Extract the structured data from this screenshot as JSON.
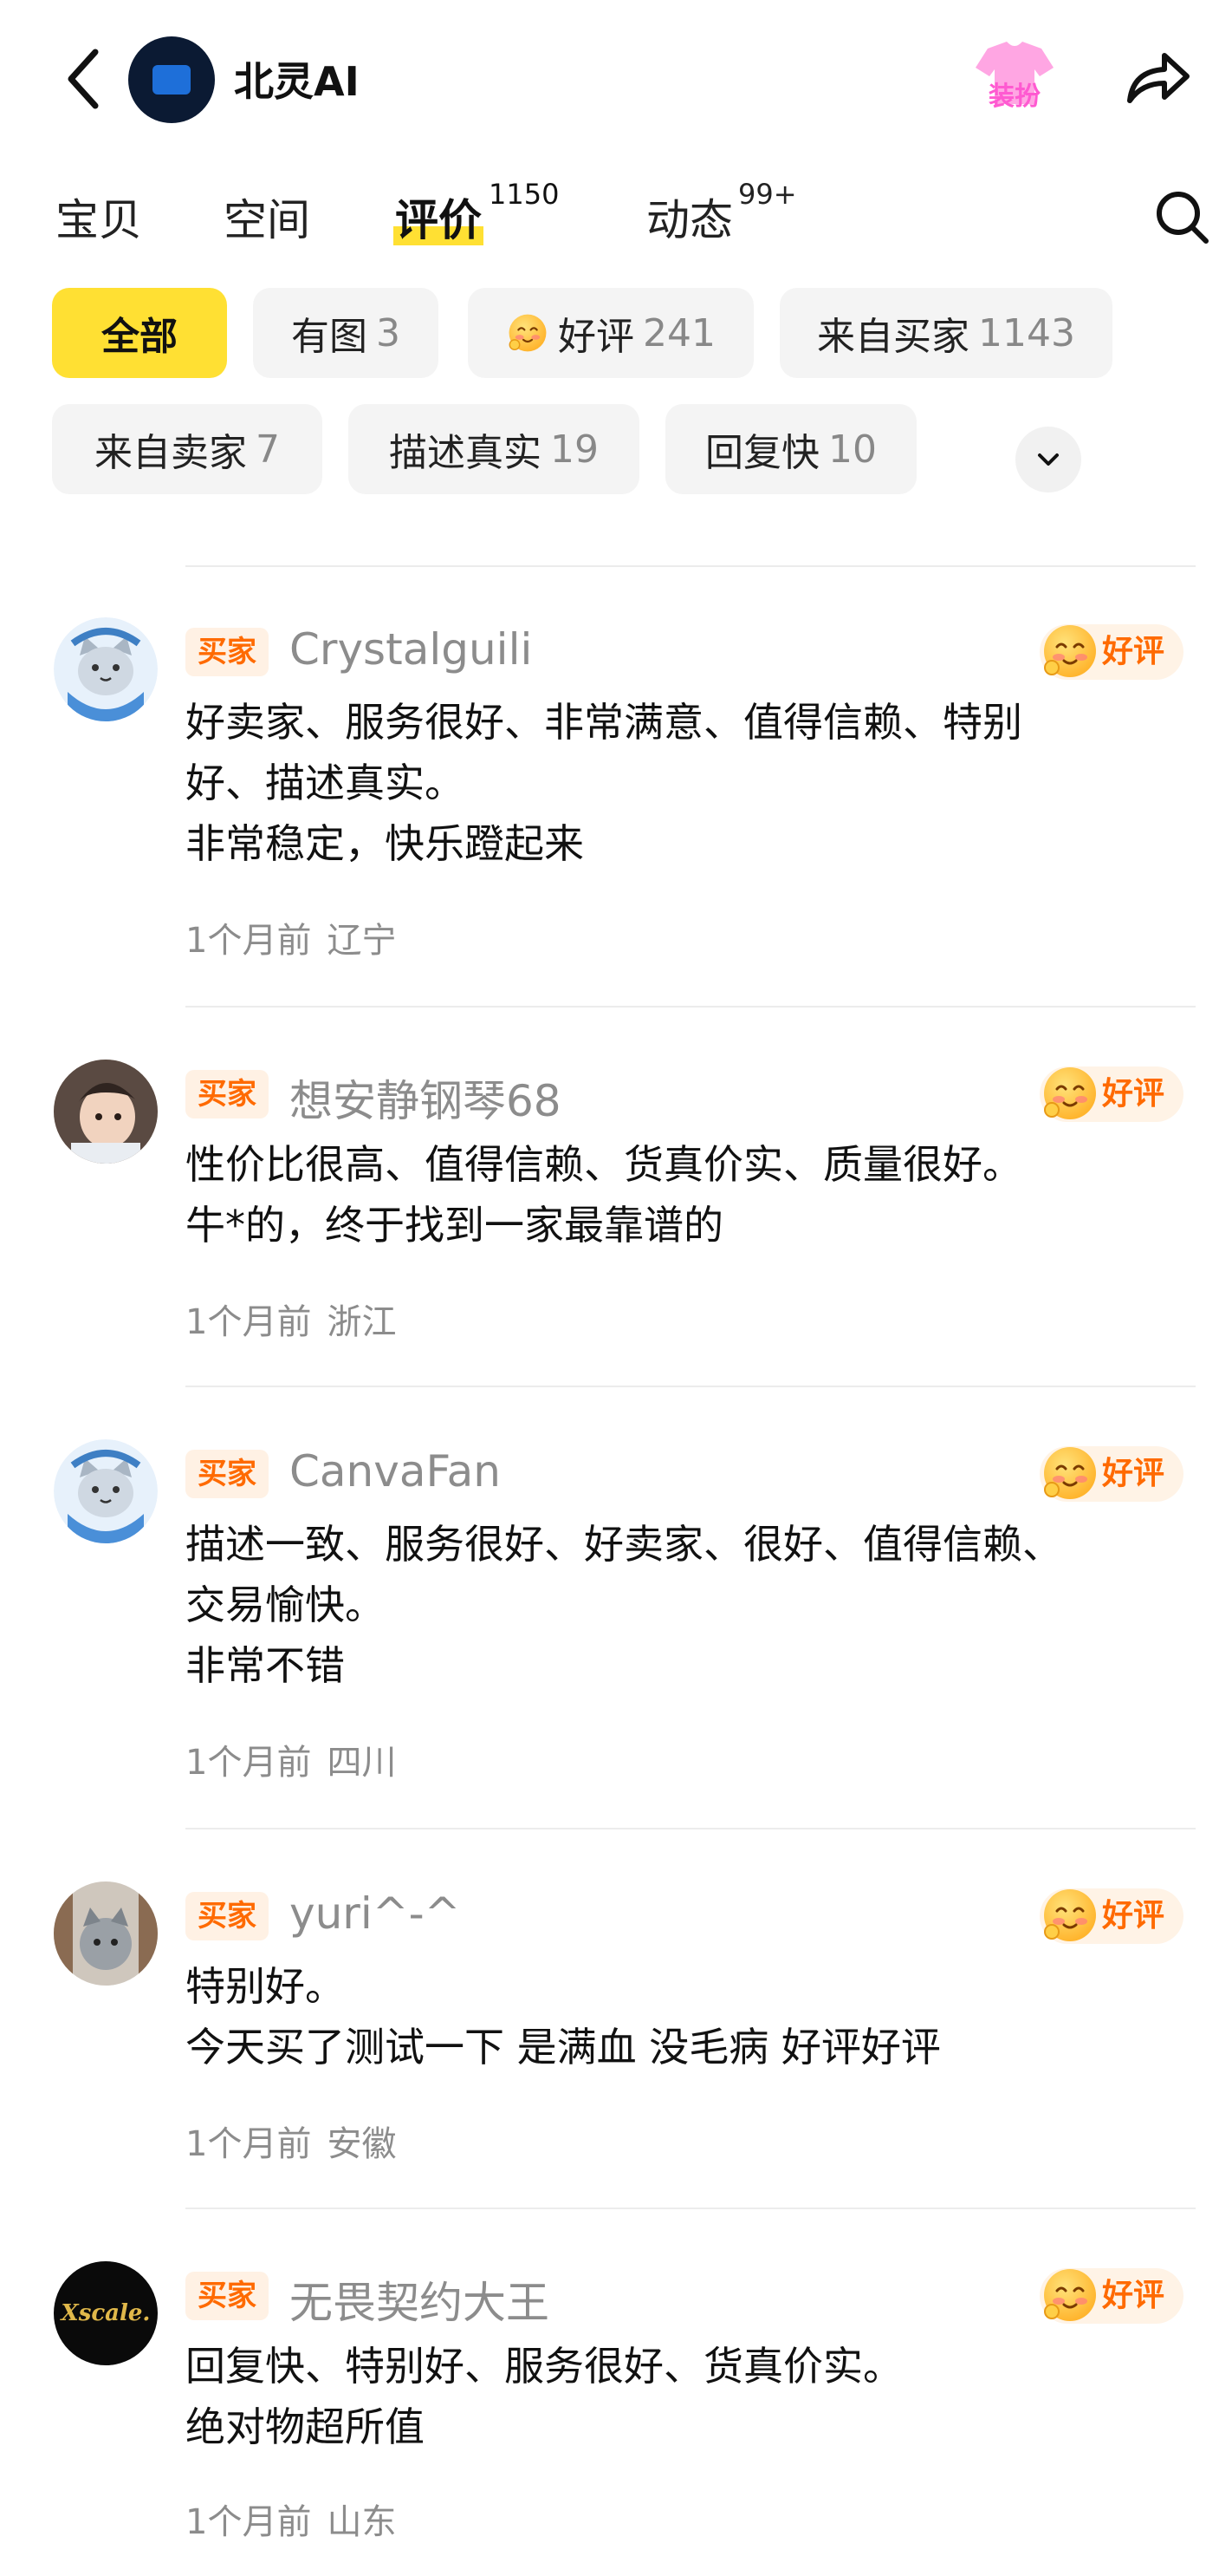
{
  "header": {
    "shop_name": "北灵AI",
    "dressup_label": "装扮"
  },
  "tabs": [
    {
      "label": "宝贝",
      "count": ""
    },
    {
      "label": "空间",
      "count": ""
    },
    {
      "label": "评价",
      "count": "1150"
    },
    {
      "label": "动态",
      "count": "99+"
    }
  ],
  "filters": [
    {
      "label": "全部",
      "count": ""
    },
    {
      "label": "有图",
      "count": "3"
    },
    {
      "label": "好评",
      "count": "241"
    },
    {
      "label": "来自买家",
      "count": "1143"
    },
    {
      "label": "来自卖家",
      "count": "7"
    },
    {
      "label": "描述真实",
      "count": "19"
    },
    {
      "label": "回复快",
      "count": "10"
    }
  ],
  "reviews": [
    {
      "role": "买家",
      "user": "Crystalguili",
      "rating": "好评",
      "lines": [
        "好卖家、服务很好、非常满意、值得信赖、特别",
        "好、描述真实。",
        "非常稳定，快乐蹬起来"
      ],
      "time": "1个月前",
      "region": "辽宁"
    },
    {
      "role": "买家",
      "user": "想安静钢琴68",
      "rating": "好评",
      "lines": [
        "性价比很高、值得信赖、货真价实、质量很好。",
        "牛*的，终于找到一家最靠谱的"
      ],
      "time": "1个月前",
      "region": "浙江"
    },
    {
      "role": "买家",
      "user": "CanvaFan",
      "rating": "好评",
      "lines": [
        "描述一致、服务很好、好卖家、很好、值得信赖、",
        "交易愉快。",
        "非常不错"
      ],
      "time": "1个月前",
      "region": "四川"
    },
    {
      "role": "买家",
      "user": "yuri^-^",
      "rating": "好评",
      "lines": [
        "特别好。",
        "今天买了测试一下 是满血 没毛病 好评好评"
      ],
      "time": "1个月前",
      "region": "安徽"
    },
    {
      "role": "买家",
      "user": "无畏契约大王",
      "rating": "好评",
      "avatar_text": "Xscale.",
      "lines": [
        "回复快、特别好、服务很好、货真价实。",
        "绝对物超所值"
      ],
      "time": "1个月前",
      "region": "山东"
    }
  ]
}
